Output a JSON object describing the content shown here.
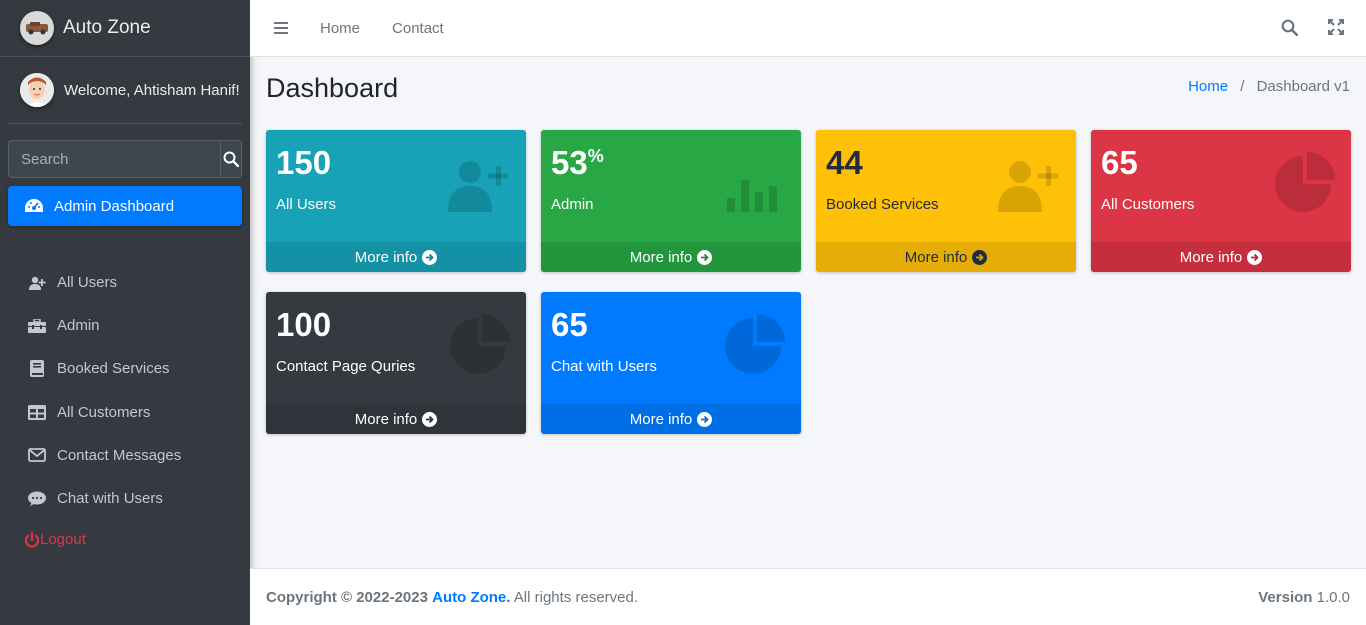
{
  "brand": {
    "name": "Auto Zone",
    "logo_icon": "car-logo-icon"
  },
  "user": {
    "welcome": "Welcome, Ahtisham Hanif!"
  },
  "search": {
    "placeholder": "Search"
  },
  "sidebar": {
    "active_item": {
      "label": "Admin Dashboard",
      "icon": "tachometer-icon"
    },
    "items": [
      {
        "label": "All Users",
        "icon": "user-plus-icon"
      },
      {
        "label": "Admin",
        "icon": "toolbox-icon"
      },
      {
        "label": "Booked Services",
        "icon": "book-icon"
      },
      {
        "label": "All Customers",
        "icon": "table-icon"
      },
      {
        "label": "Contact Messages",
        "icon": "envelope-icon"
      },
      {
        "label": "Chat with Users",
        "icon": "comment-icon"
      }
    ],
    "logout": "Logout"
  },
  "topnav": {
    "links": [
      "Home",
      "Contact"
    ]
  },
  "header": {
    "title": "Dashboard",
    "breadcrumb": [
      "Home",
      "Dashboard v1"
    ],
    "separator": "/"
  },
  "boxes": [
    {
      "value": "150",
      "suffix": "",
      "label": "All Users",
      "footer": "More info",
      "color": "#17a2b8",
      "icon": "user-plus-icon"
    },
    {
      "value": "53",
      "suffix": "%",
      "label": "Admin",
      "footer": "More info",
      "color": "#28a745",
      "icon": "bar-chart-icon"
    },
    {
      "value": "44",
      "suffix": "",
      "label": "Booked Services",
      "footer": "More info",
      "color": "#ffc107",
      "icon": "user-plus-icon"
    },
    {
      "value": "65",
      "suffix": "",
      "label": "All Customers",
      "footer": "More info",
      "color": "#dc3545",
      "icon": "pie-chart-icon"
    },
    {
      "value": "100",
      "suffix": "",
      "label": "Contact Page Quries",
      "footer": "More info",
      "color": "#343a40",
      "icon": "pie-chart-icon"
    },
    {
      "value": "65",
      "suffix": "",
      "label": "Chat with Users",
      "footer": "More info",
      "color": "#007bff",
      "icon": "pie-chart-icon"
    }
  ],
  "footer": {
    "copyright": "Copyright © 2022-2023",
    "brand": "Auto Zone.",
    "rights": "All rights reserved.",
    "version_label": "Version",
    "version": "1.0.0"
  }
}
